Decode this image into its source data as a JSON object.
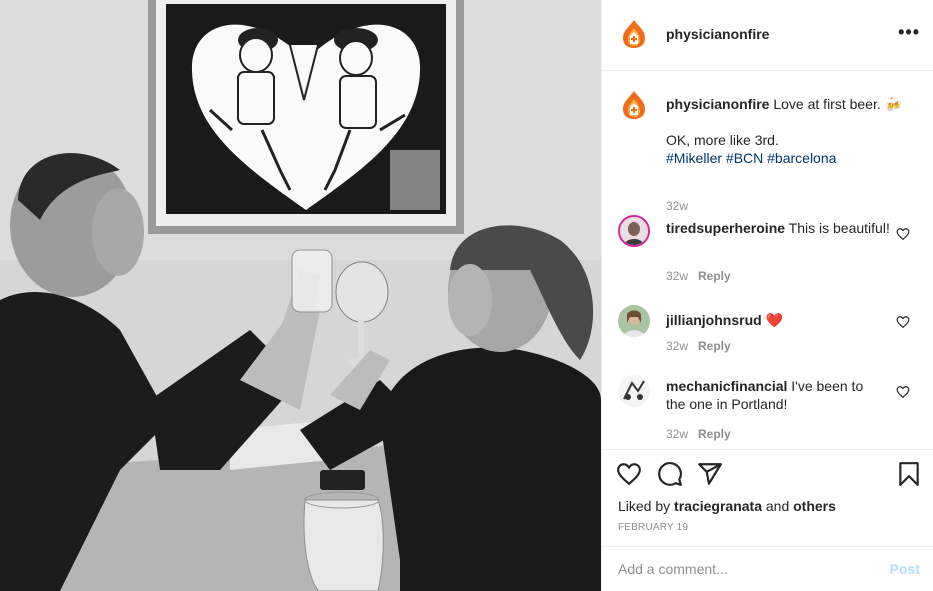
{
  "post": {
    "author": "physicianonfire",
    "more_icon": "more-options-icon",
    "caption": {
      "author": "physicianonfire",
      "line1": "Love at first beer.",
      "emoji": "🍻",
      "line2": "OK, more like 3rd.",
      "hashtags": "#Mikeller #BCN #barcelona",
      "time": "32w"
    },
    "comments": [
      {
        "user": "tiredsuperheroine",
        "text": "This is beautiful!",
        "time": "32w",
        "reply": "Reply"
      },
      {
        "user": "jillianjohnsrud",
        "text": "❤️",
        "time": "32w",
        "reply": "Reply"
      },
      {
        "user": "mechanicfinancial",
        "text": "I've been to the one in Portland!",
        "time": "32w",
        "reply": "Reply"
      }
    ],
    "likes": {
      "prefix": "Liked by",
      "user": "traciegranata",
      "and": "and",
      "others": "others"
    },
    "date": "FEBRUARY 19",
    "add_comment_placeholder": "Add a comment...",
    "post_label": "Post"
  },
  "colors": {
    "hashtag": "#00376b",
    "muted": "#8e8e8e",
    "post_disabled": "#b2dffc",
    "heart_red": "#ed4956"
  }
}
